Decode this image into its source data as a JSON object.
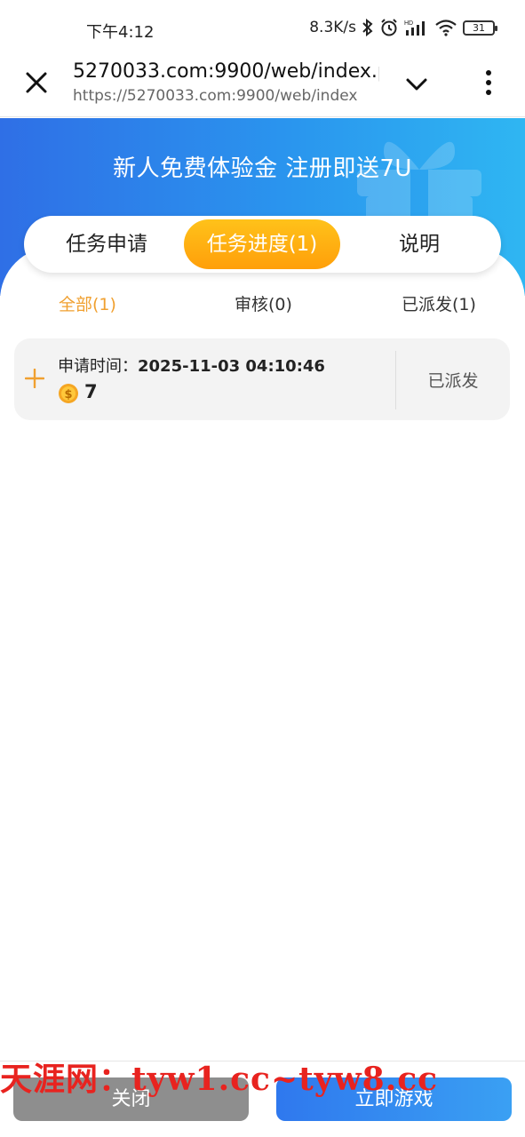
{
  "status_bar": {
    "time": "下午4:12",
    "network_speed": "8.3K/s",
    "battery": "31",
    "icons": [
      "bluetooth-icon",
      "alarm-icon",
      "signal-icon",
      "wifi-icon",
      "battery-icon"
    ]
  },
  "browser": {
    "page_title": "5270033.com:9900/web/index.p",
    "url": "https://5270033.com:9900/web/index",
    "icons": [
      "close-icon",
      "chevron-down-icon",
      "more-vert-icon"
    ]
  },
  "banner": {
    "title": "新人免费体验金 注册即送7U",
    "icon": "gift-icon"
  },
  "tabs": [
    {
      "label": "任务申请",
      "active": false
    },
    {
      "label": "任务进度(1)",
      "active": true
    },
    {
      "label": "说明",
      "active": false
    }
  ],
  "subtabs": [
    {
      "label": "全部(1)",
      "active": true
    },
    {
      "label": "审核(0)",
      "active": false
    },
    {
      "label": "已派发(1)",
      "active": false
    }
  ],
  "records": [
    {
      "time_label": "申请时间：",
      "time_value": "2025-11-03 04:10:46",
      "amount": "7",
      "status": "已派发"
    }
  ],
  "watermark": "天涯网：tyw1.cc~tyw8.cc",
  "bottom": {
    "close_label": "关闭",
    "play_label": "立即游戏"
  },
  "colors": {
    "accent_orange": "#ff9f0a",
    "banner_blue": "#2a95ee",
    "watermark_red": "#e8231f"
  }
}
